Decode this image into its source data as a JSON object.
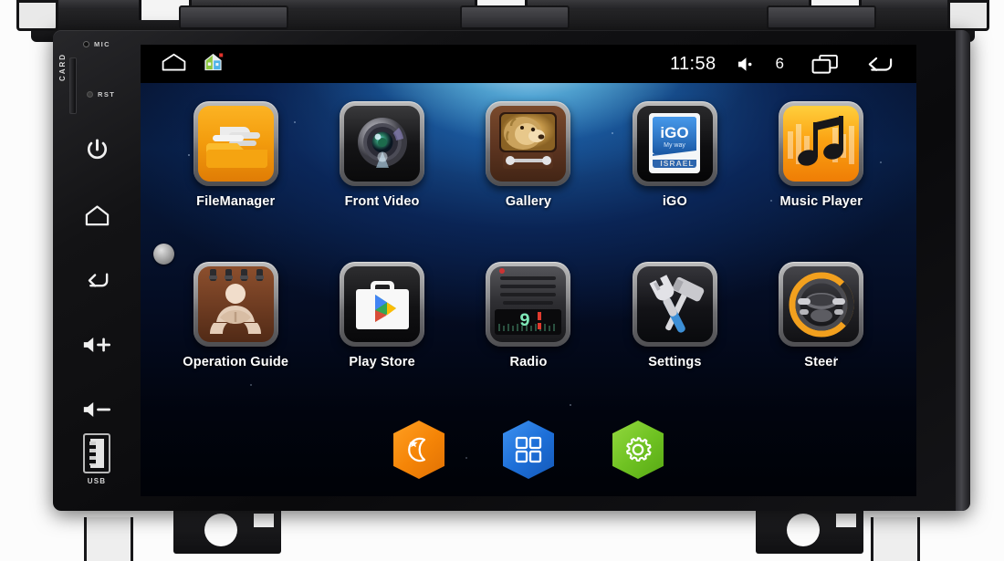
{
  "device": {
    "name": "Android car head unit",
    "bezel": {
      "mic_label": "MIC",
      "card_label": "CARD",
      "rst_label": "RST",
      "usb_label": "USB",
      "buttons": [
        {
          "name": "power-button",
          "icon": "power-icon"
        },
        {
          "name": "home-button",
          "icon": "home-icon"
        },
        {
          "name": "back-button",
          "icon": "back-arrow-icon"
        },
        {
          "name": "volume-up-button",
          "icon": "volume-up-icon"
        },
        {
          "name": "volume-down-button",
          "icon": "volume-down-icon"
        }
      ]
    }
  },
  "statusbar": {
    "left_icons": [
      {
        "name": "home-icon",
        "label": "home"
      },
      {
        "name": "launcher-house-icon",
        "label": "launcher"
      }
    ],
    "time": "11:58",
    "volume_icon": "speaker-icon",
    "volume_level": "6",
    "recents_icon": "recents-icon",
    "back_icon": "back-arrow-icon"
  },
  "home": {
    "page_indicator": "page-1",
    "apps": [
      {
        "label": "FileManager",
        "icon": "file-manager-icon"
      },
      {
        "label": "Front Video",
        "icon": "camera-icon"
      },
      {
        "label": "Gallery",
        "icon": "gallery-lion-icon"
      },
      {
        "label": "iGO",
        "icon": "igo-navigation-icon",
        "brand": "iGO",
        "tagline": "My way",
        "region": "ISRAEL"
      },
      {
        "label": "Music Player",
        "icon": "music-note-icon"
      },
      {
        "label": "Operation Guide",
        "icon": "manual-book-icon"
      },
      {
        "label": "Play Store",
        "icon": "play-store-icon"
      },
      {
        "label": "Radio",
        "icon": "radio-icon",
        "display": "9"
      },
      {
        "label": "Settings",
        "icon": "tools-icon"
      },
      {
        "label": "Steer",
        "icon": "steering-wheel-icon"
      }
    ],
    "dock": [
      {
        "name": "night-mode-button",
        "icon": "moon-star-icon",
        "color": "#f58507"
      },
      {
        "name": "all-apps-button",
        "icon": "grid-icon",
        "color": "#1d6fd8"
      },
      {
        "name": "settings-button",
        "icon": "gear-icon",
        "color": "#6fc222"
      }
    ]
  }
}
